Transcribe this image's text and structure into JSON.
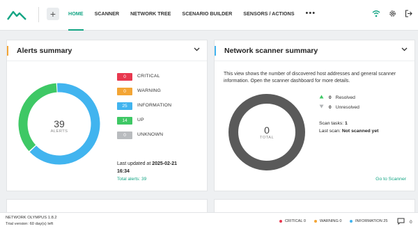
{
  "colors": {
    "accent": "#13a584",
    "critical": "#e8384f",
    "warning": "#f3a535",
    "information": "#41b4ef",
    "up": "#3ec865",
    "unknown": "#b9bcbf",
    "scanner_ring": "#5a5a5a"
  },
  "header": {
    "logo_icon": "mountain-logo-icon",
    "add_label": "+",
    "nav": [
      {
        "label": "HOME",
        "active": true
      },
      {
        "label": "SCANNER"
      },
      {
        "label": "NETWORK TREE"
      },
      {
        "label": "SCENARIO BUILDER"
      },
      {
        "label": "SENSORS / ACTIONS"
      }
    ],
    "more_label": "•••",
    "icons": [
      "wifi-icon",
      "settings-icon",
      "logout-icon"
    ]
  },
  "alerts": {
    "title": "Alerts summary",
    "total": "39",
    "center_label": "ALERTS",
    "legend": [
      {
        "count": "0",
        "label": "CRITICAL",
        "key": "critical"
      },
      {
        "count": "0",
        "label": "WARNING",
        "key": "warning"
      },
      {
        "count": "25",
        "label": "INFORMATION",
        "key": "information"
      },
      {
        "count": "14",
        "label": "UP",
        "key": "up"
      },
      {
        "count": "0",
        "label": "UNKNOWN",
        "key": "unknown"
      }
    ],
    "last_updated_prefix": "Last updated at",
    "last_updated_date": "2025-02-21",
    "last_updated_time": "16:34",
    "total_alerts": "Total alerts: 39"
  },
  "scanner": {
    "title": "Network scanner summary",
    "description": "This view shows the number of discovered host addresses and general scanner information. Open the scanner dashboard for more details.",
    "total": "0",
    "center_label": "TOTAL",
    "resolved_count": "0",
    "resolved_label": "Resolved",
    "unresolved_count": "0",
    "unresolved_label": "Unresolved",
    "scan_tasks_label": "Scan tasks:",
    "scan_tasks_value": "1",
    "last_scan_label": "Last scan:",
    "last_scan_value": "Not scanned yet",
    "goto_label": "Go to Scanner"
  },
  "footer": {
    "product": "NETWORK OLYMPUS 1.8.2",
    "trial": "Trial version: 60 day(s) left",
    "stats": [
      {
        "label": "CRITICAL 0",
        "key": "critical"
      },
      {
        "label": "WARNING 0",
        "key": "warning"
      },
      {
        "label": "INFORMATION 25",
        "key": "information"
      }
    ],
    "message_count": "0"
  }
}
